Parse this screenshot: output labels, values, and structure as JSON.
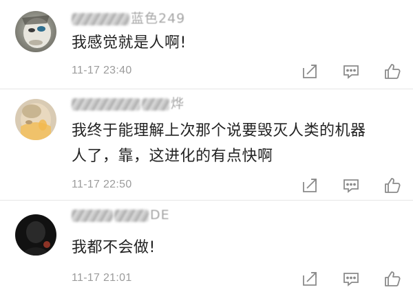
{
  "comments": [
    {
      "username": "蓝色249",
      "content": "我感觉就是人啊!",
      "time": "11-17 23:40"
    },
    {
      "username": "烨",
      "content": "我终于能理解上次那个说要毁灭人类的机器人了，靠，这进化的有点快啊",
      "time": "11-17 22:50"
    },
    {
      "username": "DE",
      "content": "我都不会做!",
      "time": "11-17 21:01"
    }
  ],
  "icons": {
    "share": "share-icon",
    "comment": "comment-icon",
    "like": "thumbs-up-icon"
  },
  "colors": {
    "text": "#222222",
    "meta": "#9b9b9b",
    "icon": "#8a8a8a"
  }
}
